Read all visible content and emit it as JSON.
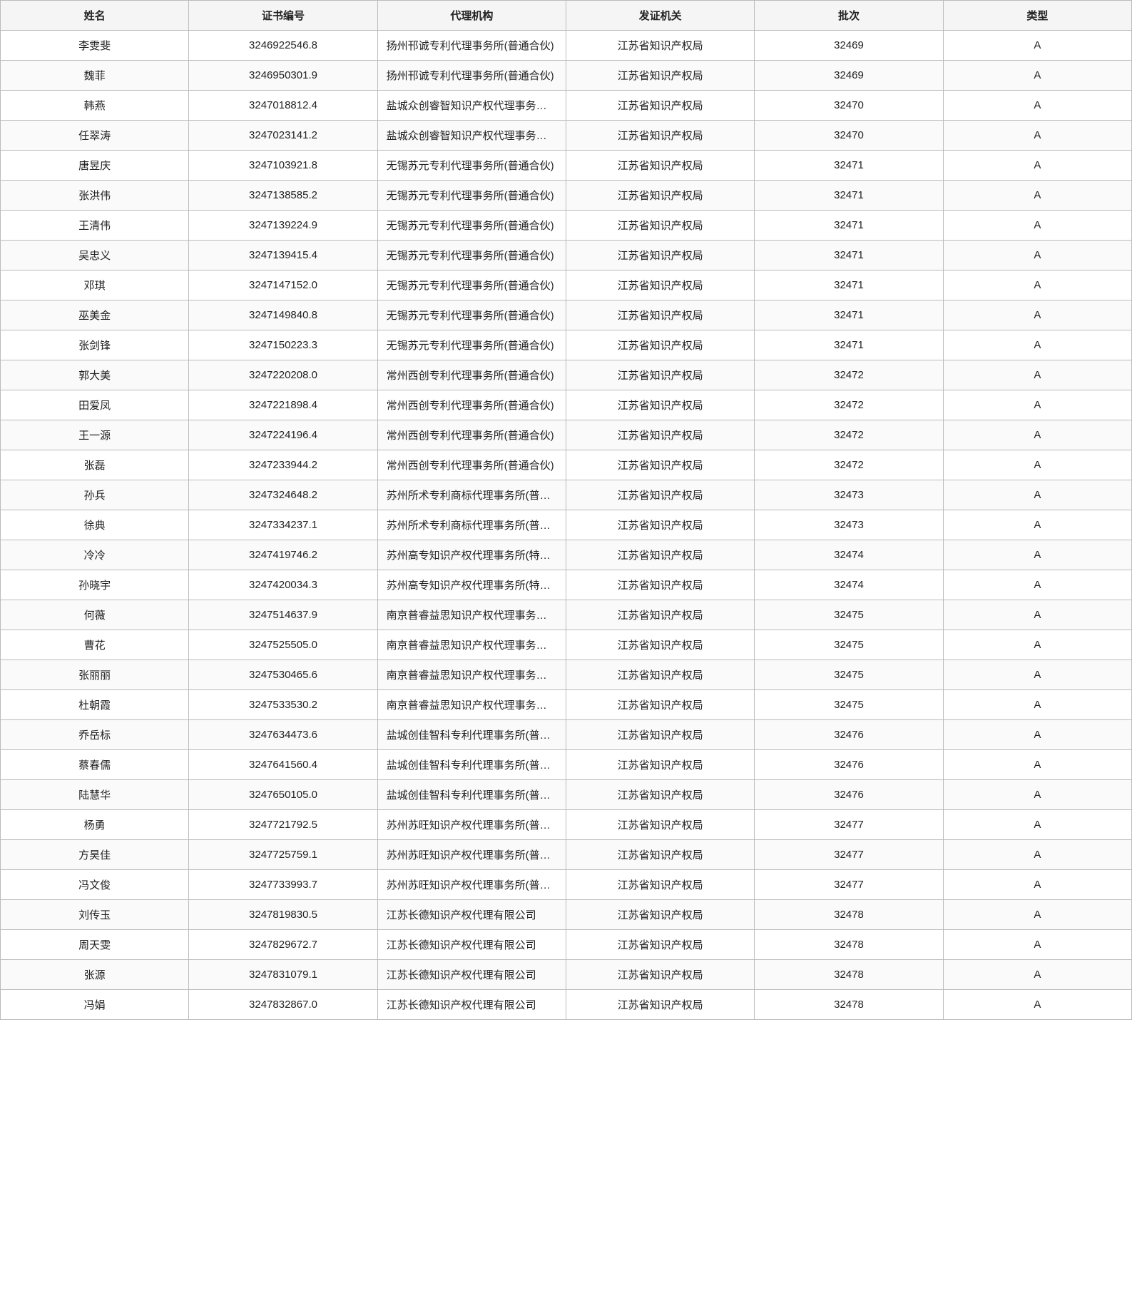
{
  "table": {
    "columns": [
      "姓名",
      "证书编号",
      "代理机构",
      "发证机关",
      "批次",
      "类型"
    ],
    "rows": [
      [
        "李雯斐",
        "3246922546.8",
        "扬州邗诚专利代理事务所(普通合伙)",
        "江苏省知识产权局",
        "32469",
        "A"
      ],
      [
        "魏菲",
        "3246950301.9",
        "扬州邗诚专利代理事务所(普通合伙)",
        "江苏省知识产权局",
        "32469",
        "A"
      ],
      [
        "韩燕",
        "3247018812.4",
        "盐城众创睿智知识产权代理事务所(普通合伙)",
        "江苏省知识产权局",
        "32470",
        "A"
      ],
      [
        "任翠涛",
        "3247023141.2",
        "盐城众创睿智知识产权代理事务所(普通合伙)",
        "江苏省知识产权局",
        "32470",
        "A"
      ],
      [
        "唐昱庆",
        "3247103921.8",
        "无锡苏元专利代理事务所(普通合伙)",
        "江苏省知识产权局",
        "32471",
        "A"
      ],
      [
        "张洪伟",
        "3247138585.2",
        "无锡苏元专利代理事务所(普通合伙)",
        "江苏省知识产权局",
        "32471",
        "A"
      ],
      [
        "王清伟",
        "3247139224.9",
        "无锡苏元专利代理事务所(普通合伙)",
        "江苏省知识产权局",
        "32471",
        "A"
      ],
      [
        "吴忠义",
        "3247139415.4",
        "无锡苏元专利代理事务所(普通合伙)",
        "江苏省知识产权局",
        "32471",
        "A"
      ],
      [
        "邓琪",
        "3247147152.0",
        "无锡苏元专利代理事务所(普通合伙)",
        "江苏省知识产权局",
        "32471",
        "A"
      ],
      [
        "巫美金",
        "3247149840.8",
        "无锡苏元专利代理事务所(普通合伙)",
        "江苏省知识产权局",
        "32471",
        "A"
      ],
      [
        "张剑锋",
        "3247150223.3",
        "无锡苏元专利代理事务所(普通合伙)",
        "江苏省知识产权局",
        "32471",
        "A"
      ],
      [
        "郭大美",
        "3247220208.0",
        "常州西创专利代理事务所(普通合伙)",
        "江苏省知识产权局",
        "32472",
        "A"
      ],
      [
        "田爱凤",
        "3247221898.4",
        "常州西创专利代理事务所(普通合伙)",
        "江苏省知识产权局",
        "32472",
        "A"
      ],
      [
        "王一源",
        "3247224196.4",
        "常州西创专利代理事务所(普通合伙)",
        "江苏省知识产权局",
        "32472",
        "A"
      ],
      [
        "张磊",
        "3247233944.2",
        "常州西创专利代理事务所(普通合伙)",
        "江苏省知识产权局",
        "32472",
        "A"
      ],
      [
        "孙兵",
        "3247324648.2",
        "苏州所术专利商标代理事务所(普通合伙)",
        "江苏省知识产权局",
        "32473",
        "A"
      ],
      [
        "徐典",
        "3247334237.1",
        "苏州所术专利商标代理事务所(普通合伙)",
        "江苏省知识产权局",
        "32473",
        "A"
      ],
      [
        "冷冷",
        "3247419746.2",
        "苏州高专知识产权代理事务所(特殊普通合伙)",
        "江苏省知识产权局",
        "32474",
        "A"
      ],
      [
        "孙晓宇",
        "3247420034.3",
        "苏州高专知识产权代理事务所(特殊普通合伙)",
        "江苏省知识产权局",
        "32474",
        "A"
      ],
      [
        "何薇",
        "3247514637.9",
        "南京普睿益思知识产权代理事务所(普通合伙)",
        "江苏省知识产权局",
        "32475",
        "A"
      ],
      [
        "曹花",
        "3247525505.0",
        "南京普睿益思知识产权代理事务所(普通合伙)",
        "江苏省知识产权局",
        "32475",
        "A"
      ],
      [
        "张丽丽",
        "3247530465.6",
        "南京普睿益思知识产权代理事务所(普通合伙)",
        "江苏省知识产权局",
        "32475",
        "A"
      ],
      [
        "杜朝霞",
        "3247533530.2",
        "南京普睿益思知识产权代理事务所(普通合伙)",
        "江苏省知识产权局",
        "32475",
        "A"
      ],
      [
        "乔岳标",
        "3247634473.6",
        "盐城创佳智科专利代理事务所(普通合伙)",
        "江苏省知识产权局",
        "32476",
        "A"
      ],
      [
        "蔡春儒",
        "3247641560.4",
        "盐城创佳智科专利代理事务所(普通合伙)",
        "江苏省知识产权局",
        "32476",
        "A"
      ],
      [
        "陆慧华",
        "3247650105.0",
        "盐城创佳智科专利代理事务所(普通合伙)",
        "江苏省知识产权局",
        "32476",
        "A"
      ],
      [
        "杨勇",
        "3247721792.5",
        "苏州苏旺知识产权代理事务所(普通合伙)",
        "江苏省知识产权局",
        "32477",
        "A"
      ],
      [
        "方昊佳",
        "3247725759.1",
        "苏州苏旺知识产权代理事务所(普通合伙)",
        "江苏省知识产权局",
        "32477",
        "A"
      ],
      [
        "冯文俊",
        "3247733993.7",
        "苏州苏旺知识产权代理事务所(普通合伙)",
        "江苏省知识产权局",
        "32477",
        "A"
      ],
      [
        "刘传玉",
        "3247819830.5",
        "江苏长德知识产权代理有限公司",
        "江苏省知识产权局",
        "32478",
        "A"
      ],
      [
        "周天雯",
        "3247829672.7",
        "江苏长德知识产权代理有限公司",
        "江苏省知识产权局",
        "32478",
        "A"
      ],
      [
        "张源",
        "3247831079.1",
        "江苏长德知识产权代理有限公司",
        "江苏省知识产权局",
        "32478",
        "A"
      ],
      [
        "冯娟",
        "3247832867.0",
        "江苏长德知识产权代理有限公司",
        "江苏省知识产权局",
        "32478",
        "A"
      ]
    ]
  }
}
